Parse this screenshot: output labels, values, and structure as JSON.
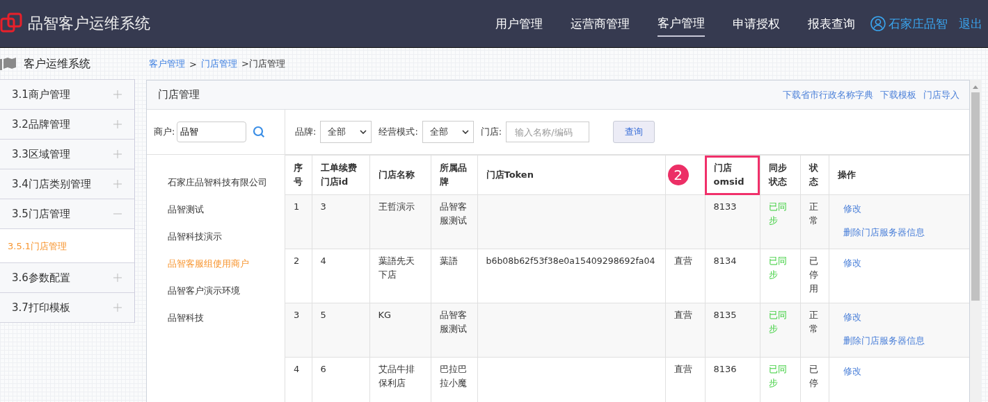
{
  "header": {
    "title": "品智客户运维系统",
    "nav": [
      {
        "label": "用户管理",
        "selected": false
      },
      {
        "label": "运营商管理",
        "selected": false
      },
      {
        "label": "客户管理",
        "selected": true
      },
      {
        "label": "申请授权",
        "selected": false
      },
      {
        "label": "报表查询",
        "selected": false
      }
    ],
    "user": "石家庄品智",
    "logout": "退出"
  },
  "sidebar": {
    "title": "客户运维系统",
    "items": [
      {
        "label": "3.1商户管理",
        "expanded": false
      },
      {
        "label": "3.2品牌管理",
        "expanded": false
      },
      {
        "label": "3.3区域管理",
        "expanded": false
      },
      {
        "label": "3.4门店类别管理",
        "expanded": false
      },
      {
        "label": "3.5门店管理",
        "expanded": true,
        "children": [
          {
            "label": "3.5.1门店管理",
            "selected": true
          }
        ]
      },
      {
        "label": "3.6参数配置",
        "expanded": false
      },
      {
        "label": "3.7打印模板",
        "expanded": false
      }
    ]
  },
  "breadcrumb": [
    {
      "label": "客户管理",
      "kind": "link"
    },
    {
      "label": ">",
      "kind": "sep"
    },
    {
      "label": "门店管理",
      "kind": "link"
    },
    {
      "label": ">门店管理",
      "kind": "text"
    }
  ],
  "panel": {
    "title": "门店管理",
    "links": [
      "下载省市行政名称字典",
      "下载模板",
      "门店导入"
    ]
  },
  "merchant_search": {
    "label": "商户:",
    "value": "品智"
  },
  "merchants": [
    {
      "name": "石家庄品智科技有限公司",
      "selected": false
    },
    {
      "name": "品智测试",
      "selected": false
    },
    {
      "name": "品智科技演示",
      "selected": false
    },
    {
      "name": "品智客服组使用商户",
      "selected": true
    },
    {
      "name": "品智客户演示环境",
      "selected": false
    },
    {
      "name": "品智科技",
      "selected": false
    }
  ],
  "filters": [
    {
      "kind": "select",
      "label": "品牌:",
      "value": "全部"
    },
    {
      "kind": "select",
      "label": "经营模式:",
      "value": "全部"
    },
    {
      "kind": "input",
      "label": "门店:",
      "placeholder": "输入名称/编码"
    }
  ],
  "query_button": "查询",
  "table": {
    "columns": [
      {
        "label": "序号"
      },
      {
        "label": "工单续费门店id"
      },
      {
        "label": "门店名称"
      },
      {
        "label": "所属品牌"
      },
      {
        "label": "门店Token"
      },
      {
        "badge": "2"
      },
      {
        "label": "门店omsid",
        "highlighted": true
      },
      {
        "label": "同步状态"
      },
      {
        "label": "状态"
      },
      {
        "label": "操作"
      }
    ],
    "rows": [
      {
        "index": "1",
        "store_id": "3",
        "name": "王哲演示",
        "brand": "品智客服测试",
        "omsid": "8133",
        "sync": "已同步",
        "status": "正常",
        "actions": [
          "修改",
          "删除门店服务器信息"
        ]
      },
      {
        "index": "2",
        "store_id": "4",
        "name": "葉語先天下店",
        "brand": "葉語",
        "token": "b6b08b62f53f38e0a15409298692fa04",
        "mode": "直营",
        "omsid": "8134",
        "sync": "已同步",
        "status": "已停用",
        "actions": [
          "修改"
        ]
      },
      {
        "index": "3",
        "store_id": "5",
        "name": "KG",
        "brand": "品智客服测试",
        "mode": "直营",
        "omsid": "8135",
        "sync": "已同步",
        "status": "正常",
        "actions": [
          "修改",
          "删除门店服务器信息"
        ]
      },
      {
        "index": "4",
        "store_id": "6",
        "name": "艾品牛排保利店",
        "brand": "巴拉巴拉小魔",
        "mode": "直营",
        "omsid": "8136",
        "sync": "已同步",
        "status": "已停",
        "actions": [
          "修改"
        ]
      }
    ]
  }
}
